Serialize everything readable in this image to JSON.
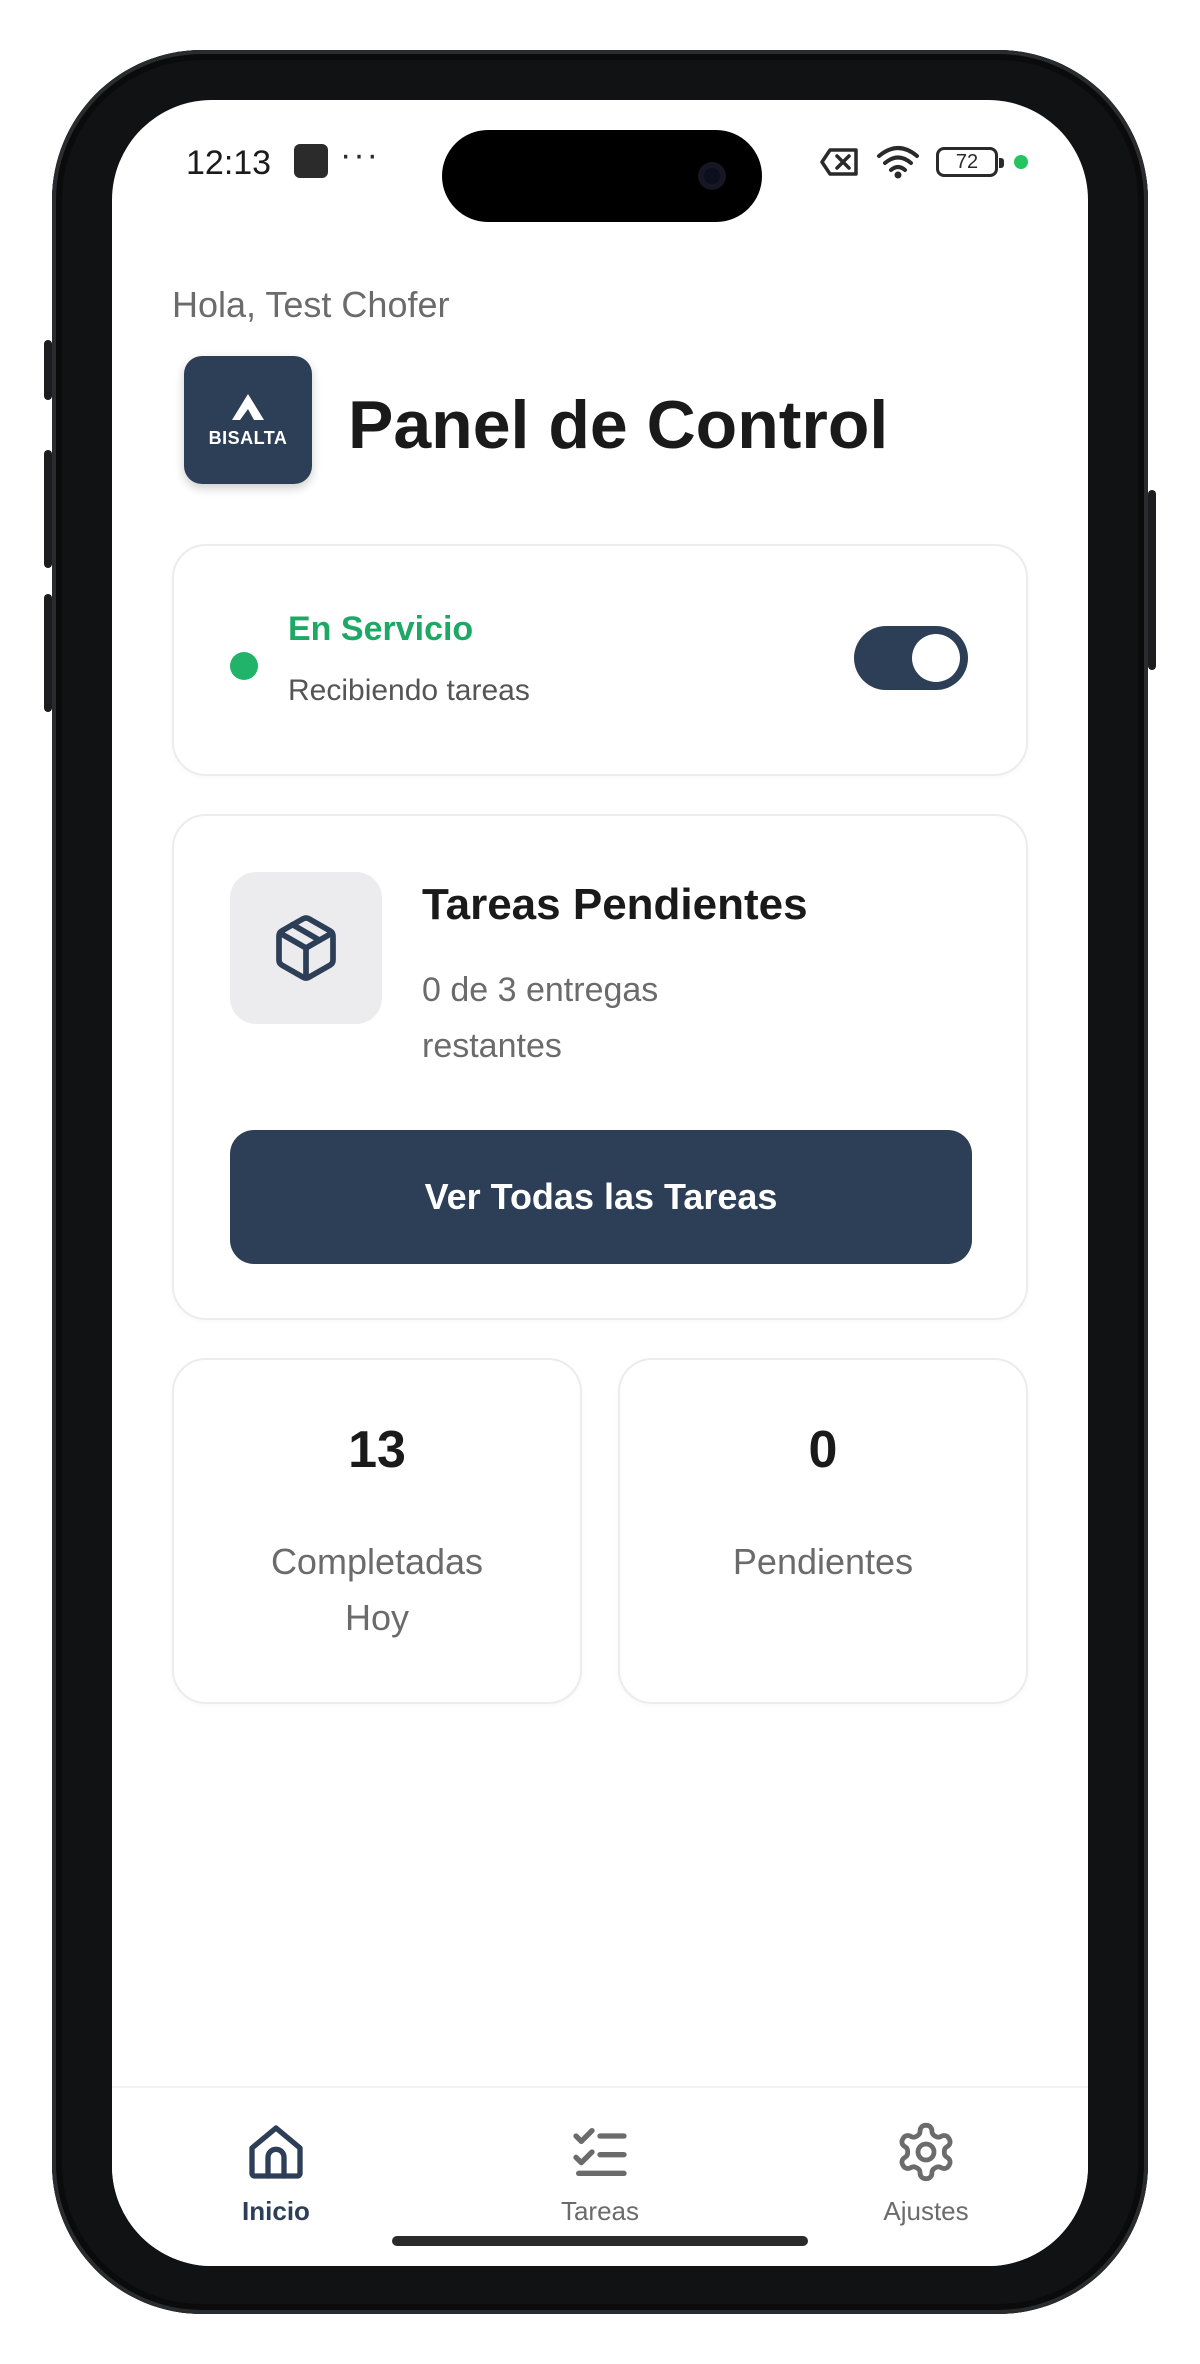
{
  "status_bar": {
    "time": "12:13",
    "dots": "···",
    "battery": "72"
  },
  "header": {
    "greeting": "Hola, Test  Chofer",
    "logo_text": "BISALTA",
    "title": "Panel de Control"
  },
  "service": {
    "title": "En Servicio",
    "subtitle": "Recibiendo tareas",
    "toggle_on": true
  },
  "tasks": {
    "title": "Tareas Pendientes",
    "subtitle": "0 de 3 entregas restantes",
    "button_label": "Ver Todas las Tareas"
  },
  "stats": [
    {
      "value": "13",
      "label": "Completadas Hoy"
    },
    {
      "value": "0",
      "label": "Pendientes"
    }
  ],
  "tabs": [
    {
      "label": "Inicio",
      "icon": "home-icon",
      "active": true
    },
    {
      "label": "Tareas",
      "icon": "checklist-icon",
      "active": false
    },
    {
      "label": "Ajustes",
      "icon": "gear-icon",
      "active": false
    }
  ],
  "colors": {
    "primary": "#2d3e57",
    "success": "#1ea865",
    "muted": "#6b6b6b"
  }
}
